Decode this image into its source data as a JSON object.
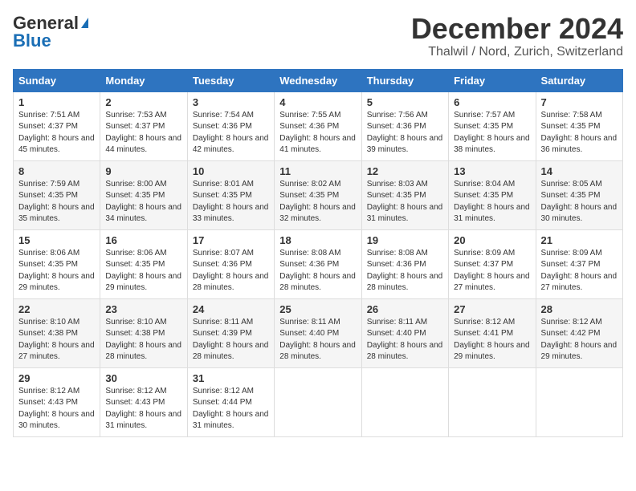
{
  "logo": {
    "general": "General",
    "blue": "Blue"
  },
  "title": {
    "month": "December 2024",
    "location": "Thalwil / Nord, Zurich, Switzerland"
  },
  "headers": [
    "Sunday",
    "Monday",
    "Tuesday",
    "Wednesday",
    "Thursday",
    "Friday",
    "Saturday"
  ],
  "weeks": [
    [
      {
        "day": "1",
        "sunrise": "Sunrise: 7:51 AM",
        "sunset": "Sunset: 4:37 PM",
        "daylight": "Daylight: 8 hours and 45 minutes."
      },
      {
        "day": "2",
        "sunrise": "Sunrise: 7:53 AM",
        "sunset": "Sunset: 4:37 PM",
        "daylight": "Daylight: 8 hours and 44 minutes."
      },
      {
        "day": "3",
        "sunrise": "Sunrise: 7:54 AM",
        "sunset": "Sunset: 4:36 PM",
        "daylight": "Daylight: 8 hours and 42 minutes."
      },
      {
        "day": "4",
        "sunrise": "Sunrise: 7:55 AM",
        "sunset": "Sunset: 4:36 PM",
        "daylight": "Daylight: 8 hours and 41 minutes."
      },
      {
        "day": "5",
        "sunrise": "Sunrise: 7:56 AM",
        "sunset": "Sunset: 4:36 PM",
        "daylight": "Daylight: 8 hours and 39 minutes."
      },
      {
        "day": "6",
        "sunrise": "Sunrise: 7:57 AM",
        "sunset": "Sunset: 4:35 PM",
        "daylight": "Daylight: 8 hours and 38 minutes."
      },
      {
        "day": "7",
        "sunrise": "Sunrise: 7:58 AM",
        "sunset": "Sunset: 4:35 PM",
        "daylight": "Daylight: 8 hours and 36 minutes."
      }
    ],
    [
      {
        "day": "8",
        "sunrise": "Sunrise: 7:59 AM",
        "sunset": "Sunset: 4:35 PM",
        "daylight": "Daylight: 8 hours and 35 minutes."
      },
      {
        "day": "9",
        "sunrise": "Sunrise: 8:00 AM",
        "sunset": "Sunset: 4:35 PM",
        "daylight": "Daylight: 8 hours and 34 minutes."
      },
      {
        "day": "10",
        "sunrise": "Sunrise: 8:01 AM",
        "sunset": "Sunset: 4:35 PM",
        "daylight": "Daylight: 8 hours and 33 minutes."
      },
      {
        "day": "11",
        "sunrise": "Sunrise: 8:02 AM",
        "sunset": "Sunset: 4:35 PM",
        "daylight": "Daylight: 8 hours and 32 minutes."
      },
      {
        "day": "12",
        "sunrise": "Sunrise: 8:03 AM",
        "sunset": "Sunset: 4:35 PM",
        "daylight": "Daylight: 8 hours and 31 minutes."
      },
      {
        "day": "13",
        "sunrise": "Sunrise: 8:04 AM",
        "sunset": "Sunset: 4:35 PM",
        "daylight": "Daylight: 8 hours and 31 minutes."
      },
      {
        "day": "14",
        "sunrise": "Sunrise: 8:05 AM",
        "sunset": "Sunset: 4:35 PM",
        "daylight": "Daylight: 8 hours and 30 minutes."
      }
    ],
    [
      {
        "day": "15",
        "sunrise": "Sunrise: 8:06 AM",
        "sunset": "Sunset: 4:35 PM",
        "daylight": "Daylight: 8 hours and 29 minutes."
      },
      {
        "day": "16",
        "sunrise": "Sunrise: 8:06 AM",
        "sunset": "Sunset: 4:35 PM",
        "daylight": "Daylight: 8 hours and 29 minutes."
      },
      {
        "day": "17",
        "sunrise": "Sunrise: 8:07 AM",
        "sunset": "Sunset: 4:36 PM",
        "daylight": "Daylight: 8 hours and 28 minutes."
      },
      {
        "day": "18",
        "sunrise": "Sunrise: 8:08 AM",
        "sunset": "Sunset: 4:36 PM",
        "daylight": "Daylight: 8 hours and 28 minutes."
      },
      {
        "day": "19",
        "sunrise": "Sunrise: 8:08 AM",
        "sunset": "Sunset: 4:36 PM",
        "daylight": "Daylight: 8 hours and 28 minutes."
      },
      {
        "day": "20",
        "sunrise": "Sunrise: 8:09 AM",
        "sunset": "Sunset: 4:37 PM",
        "daylight": "Daylight: 8 hours and 27 minutes."
      },
      {
        "day": "21",
        "sunrise": "Sunrise: 8:09 AM",
        "sunset": "Sunset: 4:37 PM",
        "daylight": "Daylight: 8 hours and 27 minutes."
      }
    ],
    [
      {
        "day": "22",
        "sunrise": "Sunrise: 8:10 AM",
        "sunset": "Sunset: 4:38 PM",
        "daylight": "Daylight: 8 hours and 27 minutes."
      },
      {
        "day": "23",
        "sunrise": "Sunrise: 8:10 AM",
        "sunset": "Sunset: 4:38 PM",
        "daylight": "Daylight: 8 hours and 28 minutes."
      },
      {
        "day": "24",
        "sunrise": "Sunrise: 8:11 AM",
        "sunset": "Sunset: 4:39 PM",
        "daylight": "Daylight: 8 hours and 28 minutes."
      },
      {
        "day": "25",
        "sunrise": "Sunrise: 8:11 AM",
        "sunset": "Sunset: 4:40 PM",
        "daylight": "Daylight: 8 hours and 28 minutes."
      },
      {
        "day": "26",
        "sunrise": "Sunrise: 8:11 AM",
        "sunset": "Sunset: 4:40 PM",
        "daylight": "Daylight: 8 hours and 28 minutes."
      },
      {
        "day": "27",
        "sunrise": "Sunrise: 8:12 AM",
        "sunset": "Sunset: 4:41 PM",
        "daylight": "Daylight: 8 hours and 29 minutes."
      },
      {
        "day": "28",
        "sunrise": "Sunrise: 8:12 AM",
        "sunset": "Sunset: 4:42 PM",
        "daylight": "Daylight: 8 hours and 29 minutes."
      }
    ],
    [
      {
        "day": "29",
        "sunrise": "Sunrise: 8:12 AM",
        "sunset": "Sunset: 4:43 PM",
        "daylight": "Daylight: 8 hours and 30 minutes."
      },
      {
        "day": "30",
        "sunrise": "Sunrise: 8:12 AM",
        "sunset": "Sunset: 4:43 PM",
        "daylight": "Daylight: 8 hours and 31 minutes."
      },
      {
        "day": "31",
        "sunrise": "Sunrise: 8:12 AM",
        "sunset": "Sunset: 4:44 PM",
        "daylight": "Daylight: 8 hours and 31 minutes."
      },
      null,
      null,
      null,
      null
    ]
  ]
}
